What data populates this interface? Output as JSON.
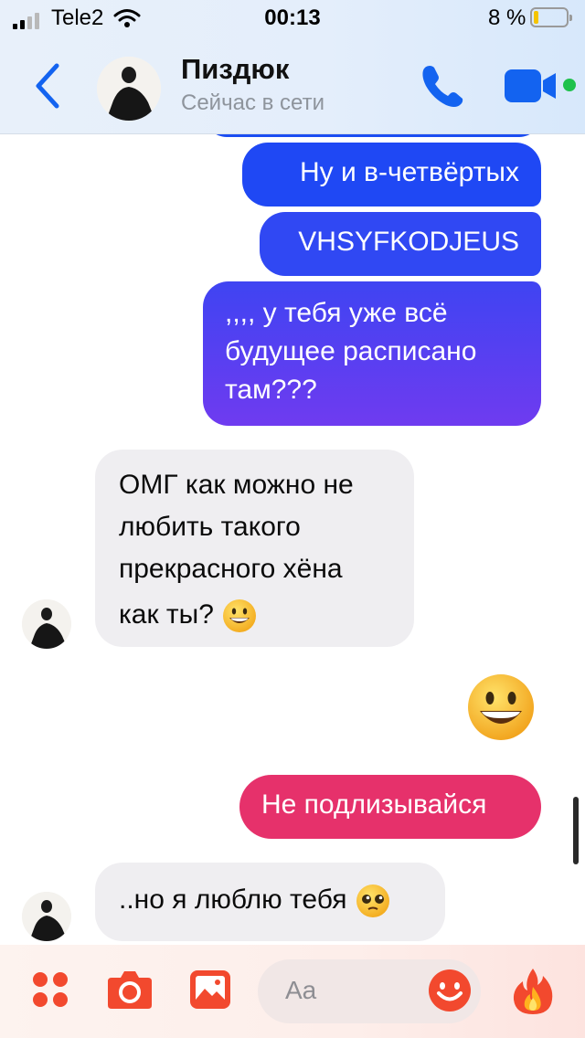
{
  "status_bar": {
    "carrier": "Tele2",
    "time": "00:13",
    "battery_percent": "8 %",
    "battery_level": 0.08
  },
  "header": {
    "contact_name": "Пиздюк",
    "contact_status": "Сейчас в сети",
    "icons": [
      "back-chevron-icon",
      "avatar",
      "phone-icon",
      "video-camera-icon",
      "online-dot"
    ]
  },
  "messages": [
    {
      "direction": "outgoing",
      "text": "Ну и в-четвёртых"
    },
    {
      "direction": "outgoing",
      "text": "VHSYFKODJEUS"
    },
    {
      "direction": "outgoing",
      "lines": [
        ",,,, у тебя уже всё",
        "будущее расписано",
        "там???"
      ]
    },
    {
      "direction": "incoming",
      "lines": [
        "ОМГ как можно не",
        "любить такого",
        "прекрасного хёна",
        "как ты?"
      ],
      "emoji": "grinning-face"
    },
    {
      "direction": "outgoing",
      "emoji": "grinning-face-big"
    },
    {
      "direction": "outgoing",
      "text": "Не подлизывайся"
    },
    {
      "direction": "incoming",
      "text": "..но я люблю тебя",
      "emoji": "pleading-face"
    }
  ],
  "composer": {
    "placeholder": "Aa",
    "icons": [
      "apps-icon",
      "camera-icon",
      "gallery-icon",
      "emoji-icon",
      "fire-icon"
    ]
  },
  "colors": {
    "accent_blue": "#1f48f4",
    "purple_end": "#6f3bf0",
    "pink_bubble": "#e6316b",
    "composer_orange": "#f2492e",
    "online_green": "#1ec14b"
  }
}
